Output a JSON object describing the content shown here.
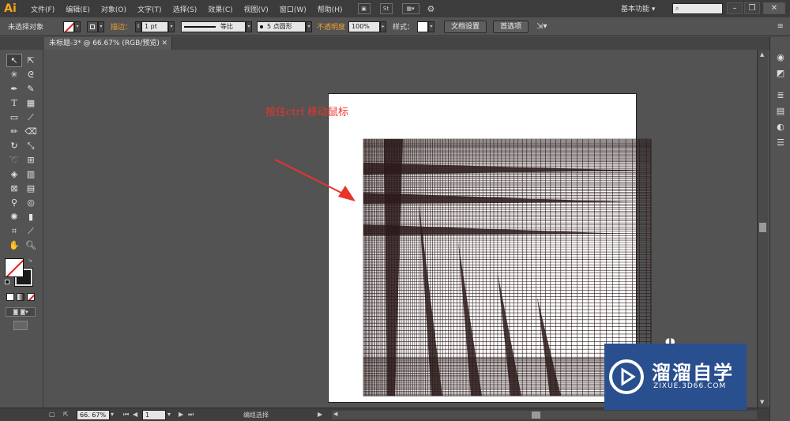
{
  "app": {
    "logo": "Ai",
    "menus": [
      "文件(F)",
      "编辑(E)",
      "对象(O)",
      "文字(T)",
      "选择(S)",
      "效果(C)",
      "视图(V)",
      "窗口(W)",
      "帮助(H)"
    ],
    "menubar_icon_st": "St",
    "workspace_label": "基本功能 ▾",
    "search_placeholder": "",
    "window_buttons": [
      "–",
      "❐",
      "✕"
    ]
  },
  "controlbar": {
    "selection_status": "未选择对象",
    "stroke_label": "描边：",
    "stroke_weight": "1 pt",
    "profile_label": "等比",
    "brush_label": "5 点圆形",
    "opacity_label": "不透明度",
    "opacity_value": "100%",
    "style_label": "样式：",
    "document_setup_button": "文档设置",
    "preferences_button": "首选项"
  },
  "document_tab": {
    "title": "未标题-3* @ 66.67% (RGB/预览)",
    "close": "✕"
  },
  "canvas": {
    "annotation": "按住ctrl  移动鼠标",
    "colors": {
      "annotation": "#e8342c",
      "arrow": "#e8342c",
      "grid_lines": "#2b1a1a"
    }
  },
  "statusbar": {
    "zoom": "66. 67%",
    "page": "1",
    "tool_status": "编组选择"
  },
  "watermark": {
    "title": "溜溜自学",
    "subtitle": "ZIXUE.3D66.COM",
    "background": "#2a4f8e"
  }
}
